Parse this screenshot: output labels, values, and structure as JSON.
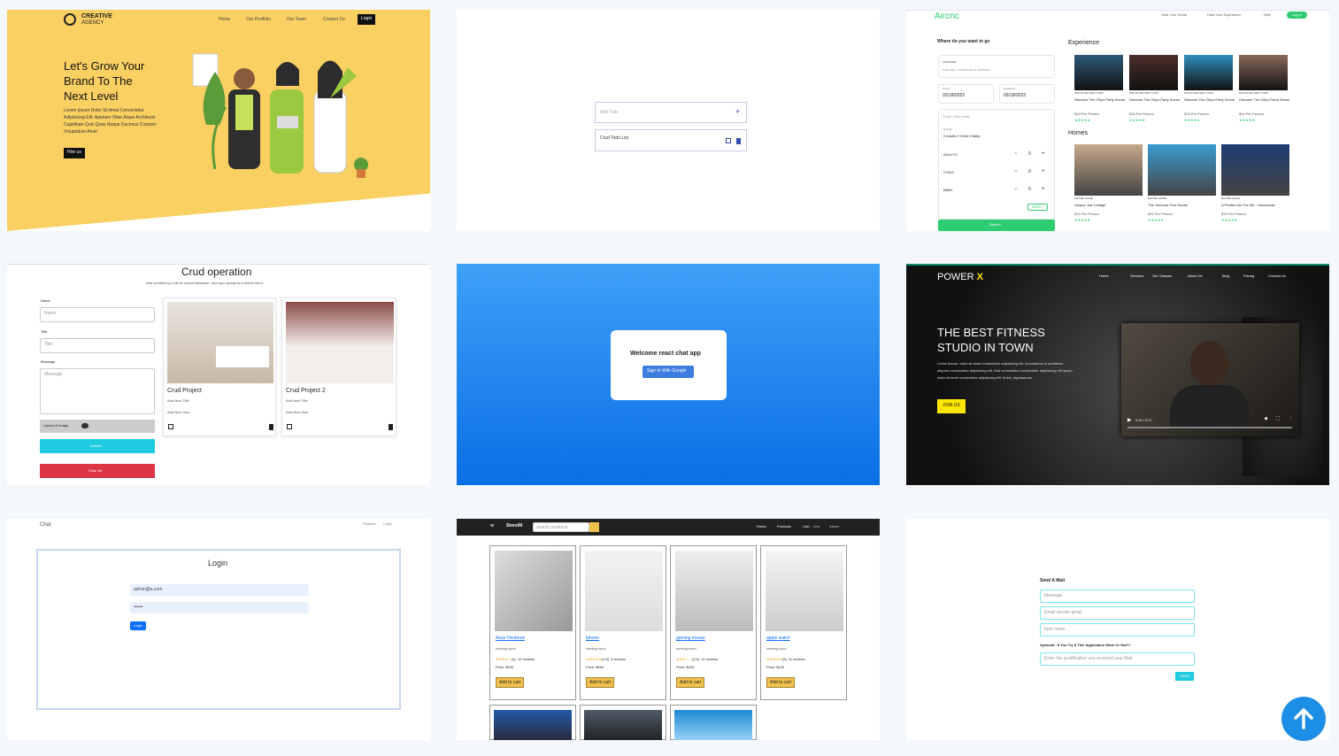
{
  "c1": {
    "logo1": "CREATIVE",
    "logo2": "AGENCY",
    "nav": [
      "Home",
      "Our Portfolio",
      "Our Team",
      "Contact Us"
    ],
    "login": "Login",
    "h1": "Let's Grow Your",
    "h2": "Brand To The",
    "h3": "Next Level",
    "p1": "Lorem Ipsum Dolor Sit Amet Consectetur",
    "p2": "Adipisicing Elit. Aperiam Vitae Atque Architecto",
    "p3": "Cupiditate Quis Quas Neque Ducimus Corporis",
    "p4": "Voluptatum Amet",
    "btn": "Hire us"
  },
  "c2": {
    "placeholder": "Add Todo",
    "plus": "+",
    "item": "Crud Todo List"
  },
  "c3": {
    "brand": "Aircnc",
    "nav": [
      "Host Your Home",
      "Host Your Experience",
      "Help"
    ],
    "login": "Log in",
    "where": "Where do you want to go",
    "loc_label": "LOCATION",
    "loc_ph": "Add city, Landmark or Address",
    "arr_label": "Arrival",
    "arr": "03/18/2022",
    "dep_label": "Departure",
    "dep": "03/18/2022",
    "email": "Enter valid email",
    "guests_label": "Guests",
    "guests": "0 Adults 0 Child 0 Baby",
    "rows": [
      {
        "l": "ADULTS",
        "v": "0"
      },
      {
        "l": "CHILD",
        "v": "0"
      },
      {
        "l": "BABY",
        "v": "0"
      }
    ],
    "apply": "APPLY",
    "search": "Search",
    "exp": "Experience",
    "homes": "Homes",
    "exp_items": [
      {
        "loc": "NIGHTLIFE NEW YORK",
        "t": "Discover The City's Party Scene",
        "p": "$15 Per Person"
      },
      {
        "loc": "NIGHTLIFE NEW YORK",
        "t": "Discover The City's Party Scene",
        "p": "$15 Per Person"
      },
      {
        "loc": "NIGHTLIFE NEW YORK",
        "t": "Discover The City's Party Scene",
        "p": "$15 Per Person"
      },
      {
        "loc": "NIGHTLIFE NEW YORK",
        "t": "Discover The City's Party Scene",
        "p": "$15 Per Person"
      }
    ],
    "home_items": [
      {
        "loc": "ENTIRE HOME",
        "t": "Unique Job Cottage",
        "p": "$15 Per Person"
      },
      {
        "loc": "ENTIRE HOME",
        "t": "The Joshuna Tree House",
        "p": "$15 Per Person"
      },
      {
        "loc": "ENTIRE HOME",
        "t": "A Pirates Life For Me - Houseboat",
        "p": "$15 Per Person"
      }
    ]
  },
  "c4": {
    "title": "Crud operation",
    "sub": "Add something it will be saved database, and also update and delete them.",
    "name_l": "Name",
    "name_ph": "Name",
    "title_l": "Title",
    "title_ph": "Title",
    "msg_l": "Message",
    "msg_ph": "Message",
    "upload": "Upload A Image",
    "submit": "Submit",
    "clear": "Clear All",
    "cards": [
      {
        "t": "Crud Project",
        "a": "Add New Title",
        "b": "Add New Sms"
      },
      {
        "t": "Crud Project 2",
        "a": "Add New Title",
        "b": "Add New Sms"
      }
    ]
  },
  "c5": {
    "welcome": "Welcome react chat app",
    "signin": "Sign In With Google"
  },
  "c6": {
    "brand": "POWER",
    "brand_x": "X",
    "nav": [
      "Home",
      "Services",
      "Our Classes",
      "About Us",
      "Blog",
      "Pricing",
      "Contact Us"
    ],
    "h1": "THE BEST FITNESS",
    "h2": "STUDIO IN TOWN",
    "p1": "Lorem ipsum, dolor sit amet consectetur adipisicing elit. Accusamus in architecto",
    "p2": "aliquam consectetur adipisicing elit. Sed consectetur consectetur adipisicing elit ipsum",
    "p3": "dolor sit amet consectetur adipisicing elit. Animi, dignissimos",
    "join": "JOIN US",
    "time": "0:00 / 0:17"
  },
  "c7": {
    "brand": "Chat",
    "register": "Register",
    "login_link": "Login",
    "title": "Login",
    "email": "admin@a.com",
    "pass": "••••••",
    "btn": "Login"
  },
  "c8": {
    "brand": "Store00",
    "search_ph": "search products",
    "nav": [
      "Home",
      "Products",
      "Cart",
      "Admin"
    ],
    "cart_user": "Ana",
    "products": [
      {
        "name": "Asus Vivobook",
        "soon": "coming soon",
        "rating": "(4)",
        "reviews": "12 reviews",
        "price": "Price: $200",
        "btn": "Add to cart"
      },
      {
        "name": "iphone",
        "soon": "coming soon",
        "rating": "(4.5)",
        "reviews": "9 reviews",
        "price": "Price: $500",
        "btn": "Add to cart"
      },
      {
        "name": "gaming mouse",
        "soon": "coming soon",
        "rating": "(3.5)",
        "reviews": "14 reviews",
        "price": "Price: $100",
        "btn": "Add to cart"
      },
      {
        "name": "apple watch",
        "soon": "coming soon",
        "rating": "(5)",
        "reviews": "11 reviews",
        "price": "Price: $120",
        "btn": "Add to cart"
      }
    ],
    "stars": [
      "★★★★☆",
      "★★★★★",
      "★★★☆☆",
      "★★★★★"
    ]
  },
  "c9": {
    "title": "Send A Mail",
    "msg_ph": "Message",
    "email_ph": "Email sender gmail",
    "name_ph": "Item name",
    "optional": "Optional : If You Try It This Application Work Or Not??",
    "opt_ph": "Enter the qualification you received your Mail",
    "send": "SEND"
  }
}
